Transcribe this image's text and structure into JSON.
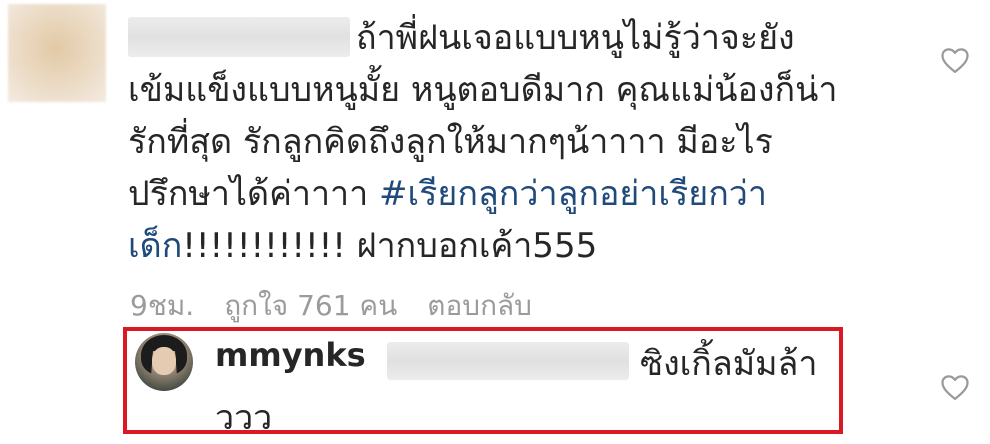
{
  "comment": {
    "text_plain": "ถ้าพี่ฝนเจอแบบหนูไม่รู้ว่าจะยังเข้มแข็งแบบหนูมั้ย หนูตอบดีมาก คุณแม่น้องก็น่ารักที่สุด รักลูกคิดถึงลูกให้มากๆน้าาาา มีอะไรปรึกษาได้ค่าาาา",
    "hashtag": "#เรียกลูกว่าลูกอย่าเรียกว่าเด็ก",
    "text_tail": "!!!!!!!!!!!! ฝากบอกเค้า555",
    "time": "9ชม.",
    "likes": "ถูกใจ 761 คน",
    "reply_label": "ตอบกลับ",
    "like_icon": "heart-outline-icon"
  },
  "reply": {
    "username": "mmynks",
    "text_line1": "ซิงเกิ้ลมัมล้า",
    "text_line2": "ววว",
    "highlight_color": "#d91923",
    "like_icon": "heart-outline-icon"
  }
}
